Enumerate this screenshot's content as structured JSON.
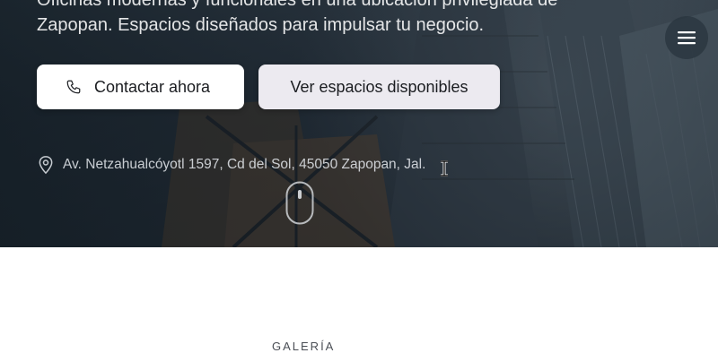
{
  "hero": {
    "description": "Oficinas modernas y funcionales en una ubicación privilegiada de Zapopan. Espacios diseñados para impulsar tu negocio.",
    "primary_button": {
      "label": "Contactar ahora",
      "icon": "phone-icon"
    },
    "secondary_button": {
      "label": "Ver espacios disponibles"
    },
    "address": {
      "text": "Av. Netzahualcóyotl 1597, Cd del Sol, 45050 Zapopan, Jal.",
      "icon": "map-pin-icon"
    }
  },
  "header": {
    "menu_icon": "hamburger-menu-icon"
  },
  "scroll_indicator": {
    "icon": "mouse-scroll-icon"
  },
  "gallery": {
    "section_label": "GALERÍA"
  },
  "colors": {
    "overlay": "#1f2830",
    "button_primary_bg": "#ffffff",
    "button_secondary_bg": "#eceaf0",
    "text_dark": "#1b1d21"
  }
}
